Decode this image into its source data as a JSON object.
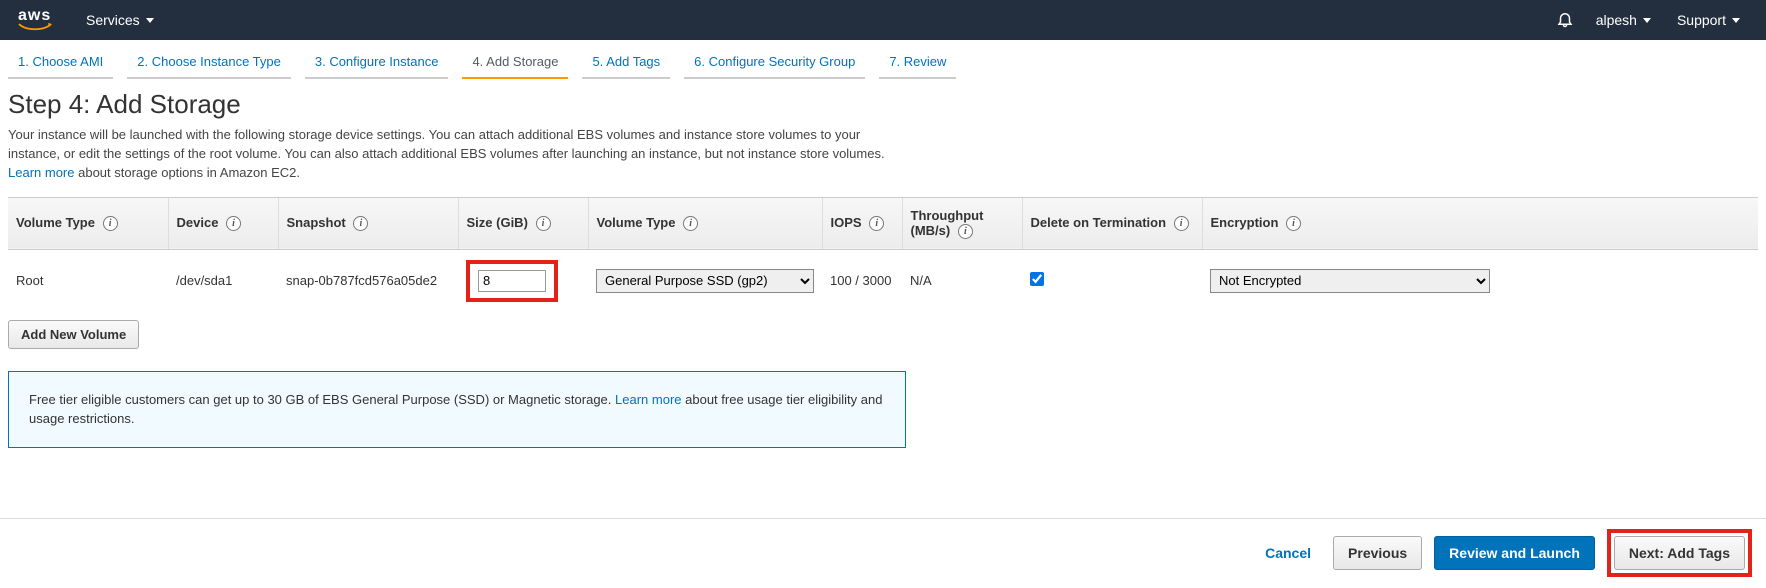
{
  "topnav": {
    "logo_text": "aws",
    "services_label": "Services",
    "user_label": "alpesh",
    "support_label": "Support"
  },
  "wizard": {
    "steps": [
      "1. Choose AMI",
      "2. Choose Instance Type",
      "3. Configure Instance",
      "4. Add Storage",
      "5. Add Tags",
      "6. Configure Security Group",
      "7. Review"
    ],
    "active_index": 3
  },
  "page": {
    "title": "Step 4: Add Storage",
    "desc_part1": "Your instance will be launched with the following storage device settings. You can attach additional EBS volumes and instance store volumes to your instance, or edit the settings of the root volume. You can also attach additional EBS volumes after launching an instance, but not instance store volumes.",
    "learn_more": "Learn more",
    "desc_part2": "about storage options in Amazon EC2."
  },
  "table": {
    "headers": {
      "volume_type_col": "Volume Type",
      "device": "Device",
      "snapshot": "Snapshot",
      "size": "Size (GiB)",
      "volume_type_sel": "Volume Type",
      "iops": "IOPS",
      "throughput": "Throughput (MB/s)",
      "delete_on_term": "Delete on Termination",
      "encryption": "Encryption"
    },
    "row": {
      "volume_type": "Root",
      "device": "/dev/sda1",
      "snapshot": "snap-0b787fcd576a05de2",
      "size": "8",
      "volume_type_select": "General Purpose SSD (gp2)",
      "iops": "100 / 3000",
      "throughput": "N/A",
      "delete_on_term": true,
      "encryption": "Not Encrypted"
    },
    "add_volume_label": "Add New Volume"
  },
  "note": {
    "text1": "Free tier eligible customers can get up to 30 GB of EBS General Purpose (SSD) or Magnetic storage.",
    "learn_more": "Learn more",
    "text2": "about free usage tier eligibility and usage restrictions."
  },
  "footer": {
    "cancel": "Cancel",
    "previous": "Previous",
    "review_launch": "Review and Launch",
    "next": "Next: Add Tags"
  }
}
